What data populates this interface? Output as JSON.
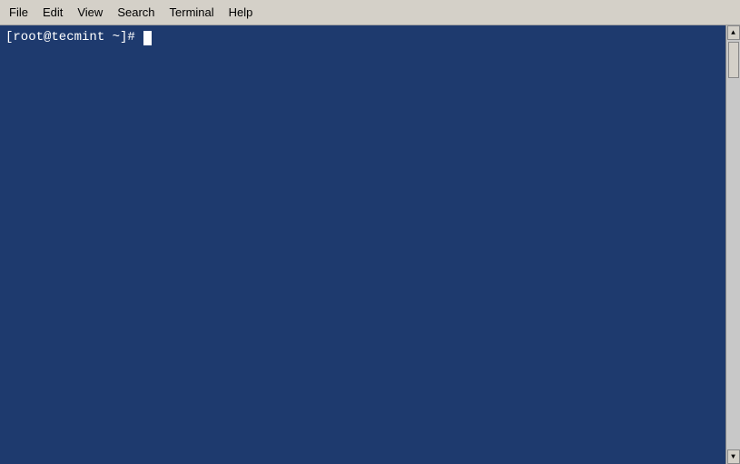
{
  "menubar": {
    "items": [
      {
        "id": "file",
        "label": "File"
      },
      {
        "id": "edit",
        "label": "Edit"
      },
      {
        "id": "view",
        "label": "View"
      },
      {
        "id": "search",
        "label": "Search"
      },
      {
        "id": "terminal",
        "label": "Terminal"
      },
      {
        "id": "help",
        "label": "Help"
      }
    ]
  },
  "terminal": {
    "prompt": "[root@tecmint ~]# ",
    "bg_color": "#1e3a6e"
  }
}
